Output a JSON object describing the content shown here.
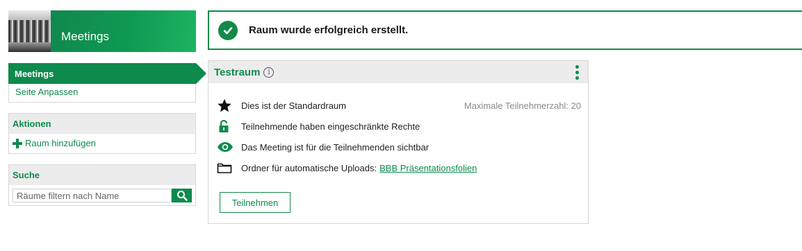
{
  "sidebar": {
    "banner_title": "Meetings",
    "nav_active": "Meetings",
    "nav_link": "Seite Anpassen",
    "actions_title": "Aktionen",
    "add_room": "Raum hinzufügen",
    "search_title": "Suche",
    "search_placeholder": "Räume filtern nach Name"
  },
  "alert": {
    "message": "Raum wurde erfolgreich erstellt."
  },
  "room": {
    "title": "Testraum",
    "default_room": "Dies ist der Standardraum",
    "max_participants": "Maximale Teilnehmerzahl: 20",
    "restricted": "Teilnehmende haben eingeschränkte Rechte",
    "visible": "Das Meeting ist für die Teilnehmenden sichtbar",
    "folder_label": "Ordner für automatische Uploads:",
    "folder_link": "BBB Präsentationsfolien",
    "join_button": "Teilnehmen"
  },
  "colors": {
    "accent": "#0e8a4c",
    "panel_header": "#ececec"
  },
  "icons": [
    "star-icon",
    "lock-icon",
    "eye-icon",
    "folder-icon",
    "info-icon",
    "kebab-menu-icon",
    "check-circle-icon",
    "plus-icon",
    "search-icon"
  ]
}
